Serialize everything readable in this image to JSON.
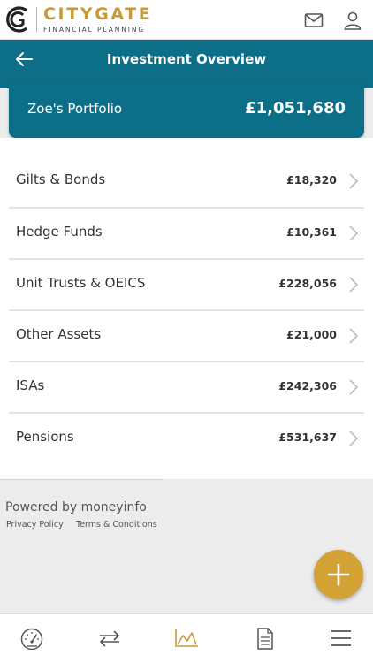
{
  "brand": {
    "name": "CITYGATE",
    "tagline": "FINANCIAL PLANNING"
  },
  "header": {
    "icons": [
      "mail-icon",
      "user-icon"
    ]
  },
  "page": {
    "title": "Investment Overview",
    "back_icon": "arrow-left-icon"
  },
  "portfolio": {
    "name": "Zoe's Portfolio",
    "total": "£1,051,680"
  },
  "holdings": [
    {
      "label": "Gilts & Bonds",
      "value": "£18,320"
    },
    {
      "label": "Hedge Funds",
      "value": "£10,361"
    },
    {
      "label": "Unit Trusts & OEICS",
      "value": "£228,056"
    },
    {
      "label": "Other Assets",
      "value": "£21,000"
    },
    {
      "label": "ISAs",
      "value": "£242,306"
    },
    {
      "label": "Pensions",
      "value": "£531,637"
    }
  ],
  "footer": {
    "powered_by": "Powered by moneyinfo",
    "privacy": "Privacy Policy",
    "terms": "Terms & Conditions"
  },
  "fab": {
    "icon": "plus-icon"
  },
  "bottom_nav": {
    "items": [
      "dashboard-gauge-icon",
      "transfer-arrows-icon",
      "chart-icon",
      "document-icon",
      "menu-icon"
    ],
    "active_index": 2
  },
  "colors": {
    "brand_gold": "#c79a3a",
    "teal": "#0d6f87",
    "fab_gold": "#d2a235"
  }
}
